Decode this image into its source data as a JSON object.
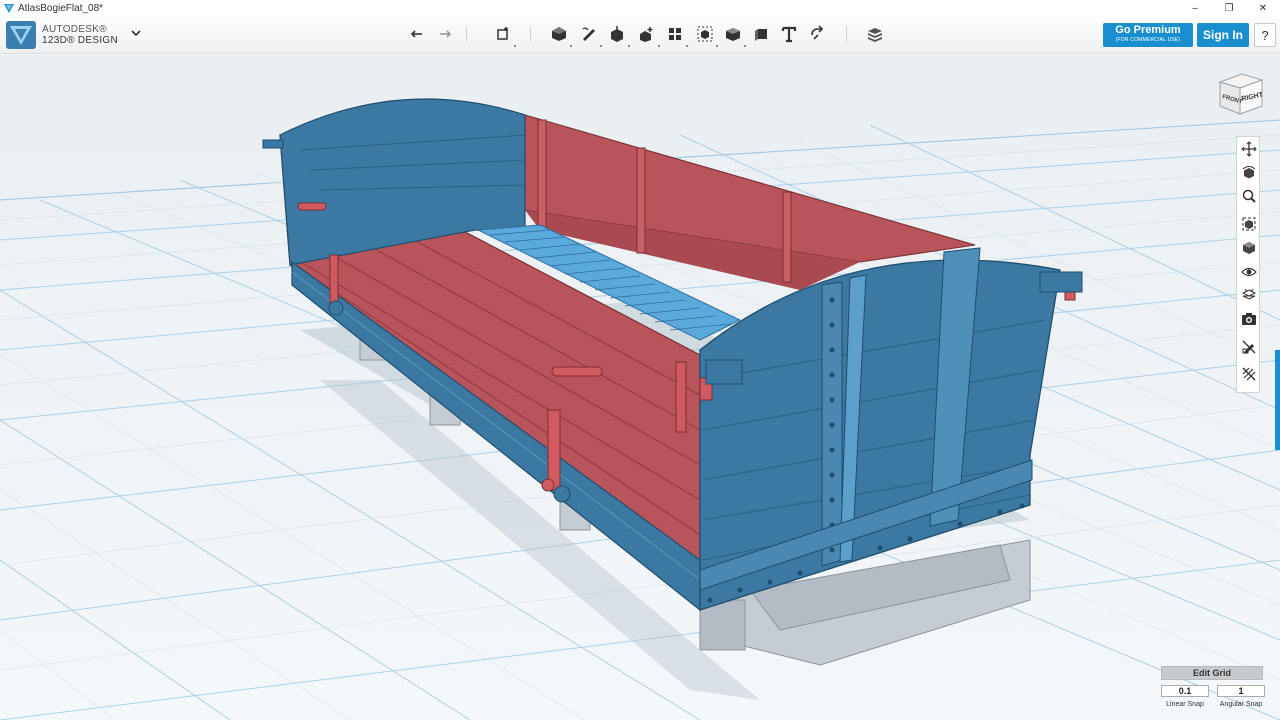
{
  "window": {
    "title": "AtlasBogieFlat_08*",
    "minimize": "–",
    "maximize": "❐",
    "close": "✕"
  },
  "brand": {
    "line1": "AUTODESK®",
    "line2": "123D® DESIGN",
    "menu_icon": "chevron-down-icon"
  },
  "toolbar": {
    "tools": [
      "undo-icon",
      "redo-icon",
      "transform-icon",
      "primitives-icon",
      "sketch-icon",
      "construct-icon",
      "modify-icon",
      "pattern-icon",
      "grouping-icon",
      "combine-icon",
      "measure-icon",
      "text-icon",
      "snap-icon",
      "material-icon"
    ]
  },
  "account": {
    "premium_label": "Go Premium",
    "premium_sub": "(FOR COMMERCIAL USE)",
    "signin_label": "Sign In",
    "help_label": "?"
  },
  "viewcube": {
    "front": "FRONT",
    "right": "RIGHT"
  },
  "nav": {
    "items": [
      "pan-icon",
      "orbit-icon",
      "zoom-icon",
      "fit-icon",
      "views-icon",
      "visibility-icon",
      "materials-outline-icon",
      "camera-icon",
      "hide-sketch-icon",
      "hide-mesh-icon"
    ]
  },
  "grid_panel": {
    "edit_label": "Edit Grid",
    "linear_value": "0.1",
    "linear_label": "Linear Snap",
    "angular_value": "1",
    "angular_label": "Angular Snap"
  },
  "colors": {
    "accent": "#1a8fd0",
    "wagon_red": "#b9555a",
    "wagon_blue": "#3b79a3",
    "floor_blue": "#5aa9dc",
    "grid": "#9cc6e3"
  }
}
